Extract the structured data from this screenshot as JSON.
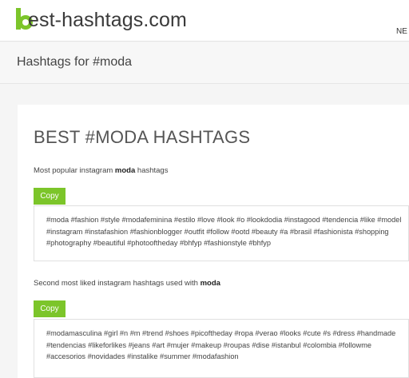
{
  "header": {
    "logo_letter": "b",
    "logo_text": "est-hashtags.com",
    "nav_new": "NE"
  },
  "subheader": {
    "title": "Hashtags for #moda"
  },
  "main": {
    "title": "BEST #MODA HASHTAGS",
    "section1": {
      "caption_prefix": "Most popular instagram ",
      "caption_keyword": "moda",
      "caption_suffix": " hashtags",
      "copy_label": "Copy",
      "lines": [
        "#moda #fashion #style #modafeminina #estilo #love #look #o #lookdodia #instagood #tendencia #like #model",
        "#instagram #instafashion #fashionblogger #outfit #follow #ootd #beauty #a #brasil #fashionista #shopping",
        "#photography #beautiful #photooftheday #bhfyp #fashionstyle #bhfyp"
      ]
    },
    "section2": {
      "caption_prefix": "Second most liked instagram hashtags used with ",
      "caption_keyword": "moda",
      "copy_label": "Copy",
      "lines": [
        "#modamasculina #girl #n #m #trend #shoes #picoftheday #ropa #verao #looks #cute #s #dress #handmade",
        "#tendencias #likeforlikes #jeans #art #mujer #makeup #roupas #dise #istanbul #colombia #followme",
        "#accesorios #novidades #instalike #summer #modafashion"
      ]
    }
  },
  "colors": {
    "logo_green": "#7cc52a",
    "copy_button": "#7cc52a"
  }
}
